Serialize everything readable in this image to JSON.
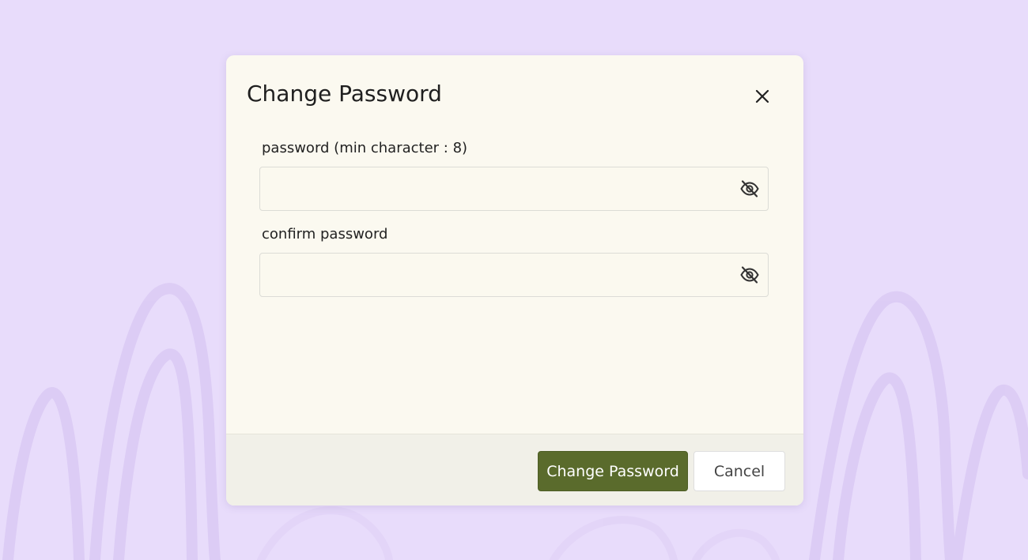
{
  "dialog": {
    "title": "Change Password",
    "close_icon": "close-icon"
  },
  "fields": {
    "password": {
      "label": "password (min character : 8)",
      "value": "",
      "toggle_icon": "eye-slash-icon"
    },
    "confirm": {
      "label": "confirm password",
      "value": "",
      "toggle_icon": "eye-slash-icon"
    }
  },
  "footer": {
    "submit_label": "Change Password",
    "cancel_label": "Cancel"
  },
  "colors": {
    "backdrop": "#e8dcfb",
    "dialog_bg": "#fbf9f0",
    "footer_bg": "#f1f0e8",
    "primary_button": "#5a6b2c"
  }
}
